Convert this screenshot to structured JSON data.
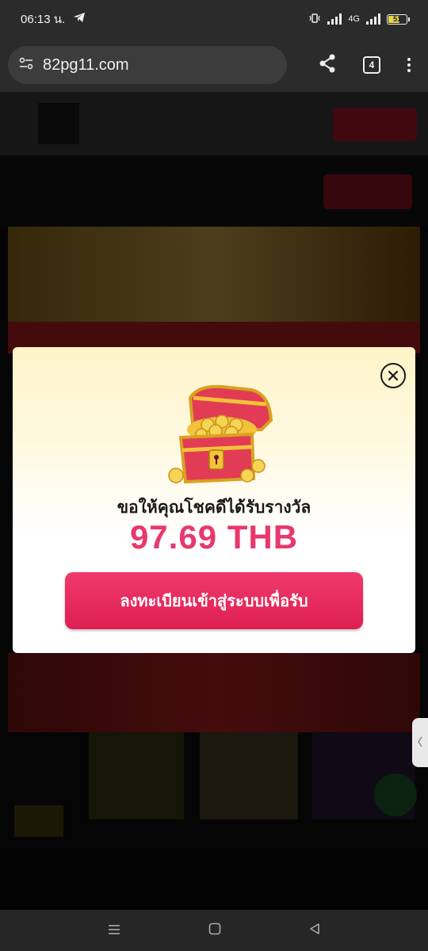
{
  "status_bar": {
    "time": "06:13 น.",
    "network": "4G",
    "battery": "51"
  },
  "browser": {
    "url": "82pg11.com",
    "tab_count": "4"
  },
  "modal": {
    "message": "ขอให้คุณโชคดีได้รับรางวัล",
    "amount": "97.69 THB",
    "cta_label": "ลงทะเบียนเข้าสู่ระบบเพื่อรับ"
  },
  "colors": {
    "accent": "#e8386c",
    "button": "#e52a5c",
    "modal_top": "#fdf4c8"
  },
  "icons": {
    "close": "close-circle-icon",
    "share": "share-icon",
    "menu": "kebab-menu-icon",
    "site_info": "site-settings-icon"
  }
}
